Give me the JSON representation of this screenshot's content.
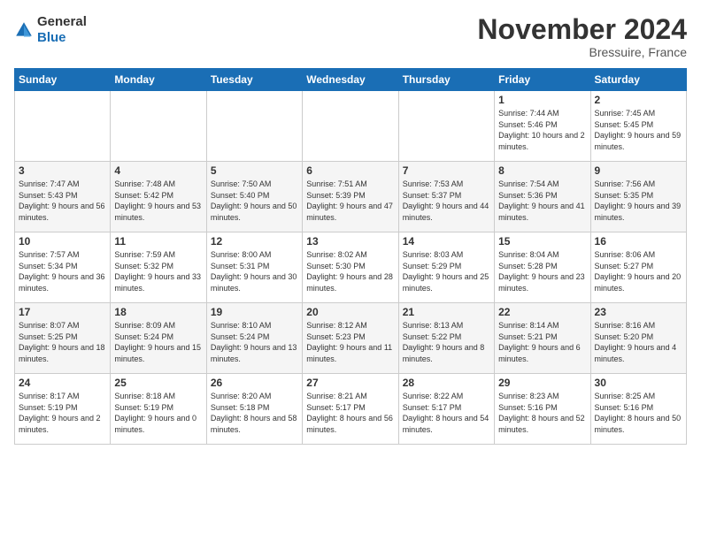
{
  "logo": {
    "general": "General",
    "blue": "Blue"
  },
  "title": "November 2024",
  "location": "Bressuire, France",
  "header_days": [
    "Sunday",
    "Monday",
    "Tuesday",
    "Wednesday",
    "Thursday",
    "Friday",
    "Saturday"
  ],
  "weeks": [
    [
      {
        "day": "",
        "info": ""
      },
      {
        "day": "",
        "info": ""
      },
      {
        "day": "",
        "info": ""
      },
      {
        "day": "",
        "info": ""
      },
      {
        "day": "",
        "info": ""
      },
      {
        "day": "1",
        "info": "Sunrise: 7:44 AM\nSunset: 5:46 PM\nDaylight: 10 hours\nand 2 minutes."
      },
      {
        "day": "2",
        "info": "Sunrise: 7:45 AM\nSunset: 5:45 PM\nDaylight: 9 hours\nand 59 minutes."
      }
    ],
    [
      {
        "day": "3",
        "info": "Sunrise: 7:47 AM\nSunset: 5:43 PM\nDaylight: 9 hours\nand 56 minutes."
      },
      {
        "day": "4",
        "info": "Sunrise: 7:48 AM\nSunset: 5:42 PM\nDaylight: 9 hours\nand 53 minutes."
      },
      {
        "day": "5",
        "info": "Sunrise: 7:50 AM\nSunset: 5:40 PM\nDaylight: 9 hours\nand 50 minutes."
      },
      {
        "day": "6",
        "info": "Sunrise: 7:51 AM\nSunset: 5:39 PM\nDaylight: 9 hours\nand 47 minutes."
      },
      {
        "day": "7",
        "info": "Sunrise: 7:53 AM\nSunset: 5:37 PM\nDaylight: 9 hours\nand 44 minutes."
      },
      {
        "day": "8",
        "info": "Sunrise: 7:54 AM\nSunset: 5:36 PM\nDaylight: 9 hours\nand 41 minutes."
      },
      {
        "day": "9",
        "info": "Sunrise: 7:56 AM\nSunset: 5:35 PM\nDaylight: 9 hours\nand 39 minutes."
      }
    ],
    [
      {
        "day": "10",
        "info": "Sunrise: 7:57 AM\nSunset: 5:34 PM\nDaylight: 9 hours\nand 36 minutes."
      },
      {
        "day": "11",
        "info": "Sunrise: 7:59 AM\nSunset: 5:32 PM\nDaylight: 9 hours\nand 33 minutes."
      },
      {
        "day": "12",
        "info": "Sunrise: 8:00 AM\nSunset: 5:31 PM\nDaylight: 9 hours\nand 30 minutes."
      },
      {
        "day": "13",
        "info": "Sunrise: 8:02 AM\nSunset: 5:30 PM\nDaylight: 9 hours\nand 28 minutes."
      },
      {
        "day": "14",
        "info": "Sunrise: 8:03 AM\nSunset: 5:29 PM\nDaylight: 9 hours\nand 25 minutes."
      },
      {
        "day": "15",
        "info": "Sunrise: 8:04 AM\nSunset: 5:28 PM\nDaylight: 9 hours\nand 23 minutes."
      },
      {
        "day": "16",
        "info": "Sunrise: 8:06 AM\nSunset: 5:27 PM\nDaylight: 9 hours\nand 20 minutes."
      }
    ],
    [
      {
        "day": "17",
        "info": "Sunrise: 8:07 AM\nSunset: 5:25 PM\nDaylight: 9 hours\nand 18 minutes."
      },
      {
        "day": "18",
        "info": "Sunrise: 8:09 AM\nSunset: 5:24 PM\nDaylight: 9 hours\nand 15 minutes."
      },
      {
        "day": "19",
        "info": "Sunrise: 8:10 AM\nSunset: 5:24 PM\nDaylight: 9 hours\nand 13 minutes."
      },
      {
        "day": "20",
        "info": "Sunrise: 8:12 AM\nSunset: 5:23 PM\nDaylight: 9 hours\nand 11 minutes."
      },
      {
        "day": "21",
        "info": "Sunrise: 8:13 AM\nSunset: 5:22 PM\nDaylight: 9 hours\nand 8 minutes."
      },
      {
        "day": "22",
        "info": "Sunrise: 8:14 AM\nSunset: 5:21 PM\nDaylight: 9 hours\nand 6 minutes."
      },
      {
        "day": "23",
        "info": "Sunrise: 8:16 AM\nSunset: 5:20 PM\nDaylight: 9 hours\nand 4 minutes."
      }
    ],
    [
      {
        "day": "24",
        "info": "Sunrise: 8:17 AM\nSunset: 5:19 PM\nDaylight: 9 hours\nand 2 minutes."
      },
      {
        "day": "25",
        "info": "Sunrise: 8:18 AM\nSunset: 5:19 PM\nDaylight: 9 hours\nand 0 minutes."
      },
      {
        "day": "26",
        "info": "Sunrise: 8:20 AM\nSunset: 5:18 PM\nDaylight: 8 hours\nand 58 minutes."
      },
      {
        "day": "27",
        "info": "Sunrise: 8:21 AM\nSunset: 5:17 PM\nDaylight: 8 hours\nand 56 minutes."
      },
      {
        "day": "28",
        "info": "Sunrise: 8:22 AM\nSunset: 5:17 PM\nDaylight: 8 hours\nand 54 minutes."
      },
      {
        "day": "29",
        "info": "Sunrise: 8:23 AM\nSunset: 5:16 PM\nDaylight: 8 hours\nand 52 minutes."
      },
      {
        "day": "30",
        "info": "Sunrise: 8:25 AM\nSunset: 5:16 PM\nDaylight: 8 hours\nand 50 minutes."
      }
    ]
  ]
}
